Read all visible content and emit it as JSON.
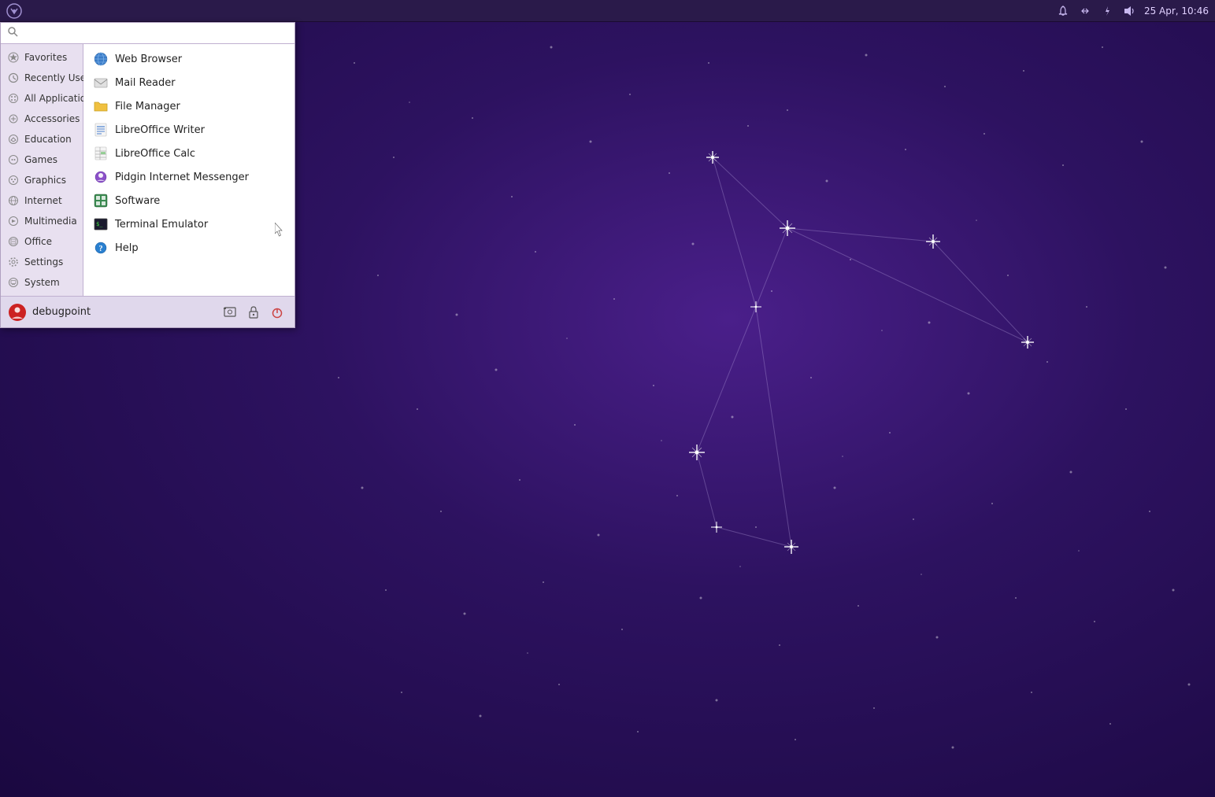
{
  "taskbar": {
    "datetime": "25 Apr, 10:46",
    "logo_title": "XFCE"
  },
  "search": {
    "placeholder": "",
    "value": ""
  },
  "sidebar": {
    "items": [
      {
        "id": "favorites",
        "label": "Favorites",
        "icon": "star"
      },
      {
        "id": "recently-used",
        "label": "Recently Used",
        "icon": "clock"
      },
      {
        "id": "all-applications",
        "label": "All Applications",
        "icon": "grid"
      },
      {
        "id": "accessories",
        "label": "Accessories",
        "icon": "accessories"
      },
      {
        "id": "education",
        "label": "Education",
        "icon": "education"
      },
      {
        "id": "games",
        "label": "Games",
        "icon": "games"
      },
      {
        "id": "graphics",
        "label": "Graphics",
        "icon": "graphics"
      },
      {
        "id": "internet",
        "label": "Internet",
        "icon": "internet"
      },
      {
        "id": "multimedia",
        "label": "Multimedia",
        "icon": "multimedia"
      },
      {
        "id": "office",
        "label": "Office",
        "icon": "office"
      },
      {
        "id": "settings",
        "label": "Settings",
        "icon": "settings"
      },
      {
        "id": "system",
        "label": "System",
        "icon": "system"
      }
    ]
  },
  "apps": {
    "items": [
      {
        "id": "web-browser",
        "label": "Web Browser",
        "icon": "globe"
      },
      {
        "id": "mail-reader",
        "label": "Mail Reader",
        "icon": "mail"
      },
      {
        "id": "file-manager",
        "label": "File Manager",
        "icon": "folder"
      },
      {
        "id": "libreoffice-writer",
        "label": "LibreOffice Writer",
        "icon": "writer"
      },
      {
        "id": "libreoffice-calc",
        "label": "LibreOffice Calc",
        "icon": "calc"
      },
      {
        "id": "pidgin",
        "label": "Pidgin Internet Messenger",
        "icon": "pidgin"
      },
      {
        "id": "software",
        "label": "Software",
        "icon": "software"
      },
      {
        "id": "terminal-emulator",
        "label": "Terminal Emulator",
        "icon": "terminal"
      },
      {
        "id": "help",
        "label": "Help",
        "icon": "help"
      }
    ]
  },
  "bottom": {
    "username": "debugpoint",
    "btn_screenshot": "Screenshot",
    "btn_lock": "Lock Screen",
    "btn_power": "Power"
  }
}
